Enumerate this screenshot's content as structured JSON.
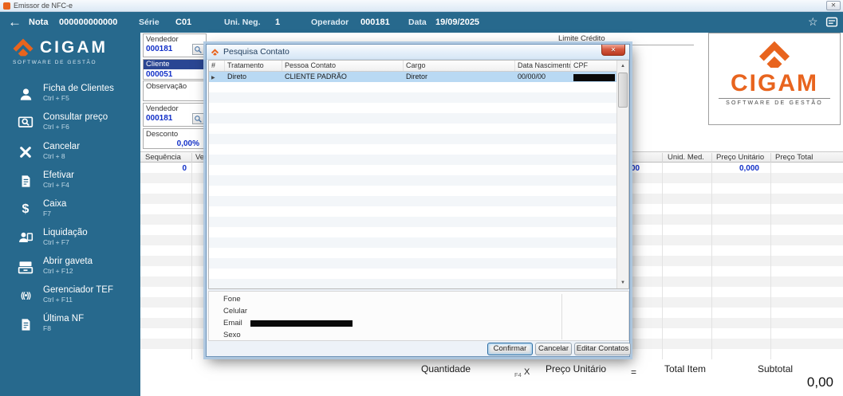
{
  "window": {
    "title": "Emissor de NFC-e"
  },
  "icons": {
    "close": "✕",
    "back": "←",
    "star": "☆",
    "dollar": "$",
    "wireless": "((•))",
    "scroll_up": "▲",
    "scroll_down": "▼",
    "row_marker": "▶"
  },
  "logo": {
    "text": "CIGAM",
    "subtitle": "SOFTWARE DE GESTÃO"
  },
  "header": {
    "nota_label": "Nota",
    "nota_value": "000000000000",
    "serie_label": "Série",
    "serie_value": "C01",
    "uni_neg_label": "Uni. Neg.",
    "uni_neg_value": "1",
    "operador_label": "Operador",
    "operador_value": "000181",
    "data_label": "Data",
    "data_value": "19/09/2025"
  },
  "sidebar": {
    "items": [
      {
        "label": "Ficha de Clientes",
        "shortcut": "Ctrl + F5",
        "icon": "person-icon"
      },
      {
        "label": "Consultar preço",
        "shortcut": "Ctrl + F6",
        "icon": "price-search-icon"
      },
      {
        "label": "Cancelar",
        "shortcut": "Ctrl + 8",
        "icon": "cancel-x-icon"
      },
      {
        "label": "Efetivar",
        "shortcut": "Ctrl + F4",
        "icon": "document-icon"
      },
      {
        "label": "Caixa",
        "shortcut": "F7",
        "icon": "dollar-icon"
      },
      {
        "label": "Liquidação",
        "shortcut": "Ctrl + F7",
        "icon": "cashier-icon"
      },
      {
        "label": "Abrir gaveta",
        "shortcut": "Ctrl + F12",
        "icon": "cash-drawer-icon"
      },
      {
        "label": "Gerenciador TEF",
        "shortcut": "Ctrl + F11",
        "icon": "wireless-icon"
      },
      {
        "label": "Última NF",
        "shortcut": "F8",
        "icon": "invoice-icon"
      }
    ]
  },
  "form": {
    "vendedor_label": "Vendedor",
    "vendedor_value": "000181",
    "cliente_label": "Cliente",
    "cliente_value": "000051",
    "observacao_label": "Observação",
    "vendedor2_label": "Vendedor",
    "vendedor2_value": "000181",
    "desconto_label": "Desconto",
    "desconto_value": "0,00%",
    "limite_credito_label": "Limite Crédito"
  },
  "items_table": {
    "columns": [
      "Sequência",
      "Vend",
      "Unid. Med.",
      "Preço Unitário",
      "Preço Total"
    ],
    "row": {
      "sequencia": "0",
      "partial_value": "00",
      "preco_unitario": "0,000"
    }
  },
  "dialog": {
    "title": "Pesquisa Contato",
    "columns": [
      "#",
      "Tratamento",
      "Pessoa Contato",
      "Cargo",
      "Data Nascimento",
      "CPF"
    ],
    "row": {
      "tratamento": "Direto",
      "pessoa_contato": "CLIENTE PADRÃO",
      "cargo": "Diretor",
      "data_nascimento": "00/00/00",
      "cpf_redacted": true
    },
    "details": {
      "fone_label": "Fone",
      "celular_label": "Celular",
      "email_label": "Email",
      "email_redacted": true,
      "sexo_label": "Sexo"
    },
    "buttons": {
      "confirmar": "Confirmar",
      "cancelar": "Cancelar",
      "editar_contatos": "Editar Contatos"
    }
  },
  "footer": {
    "quantidade_label": "Quantidade",
    "f4_hint": "F4",
    "multiply": "X",
    "preco_unitario_label": "Preço Unitário",
    "equals": "=",
    "total_item_label": "Total Item",
    "subtotal_label": "Subtotal",
    "subtotal_value": "0,00"
  },
  "colors": {
    "brand_teal": "#27698D",
    "brand_orange": "#E8641E",
    "value_blue": "#1230C8",
    "selection_blue": "#B9D9F3"
  }
}
